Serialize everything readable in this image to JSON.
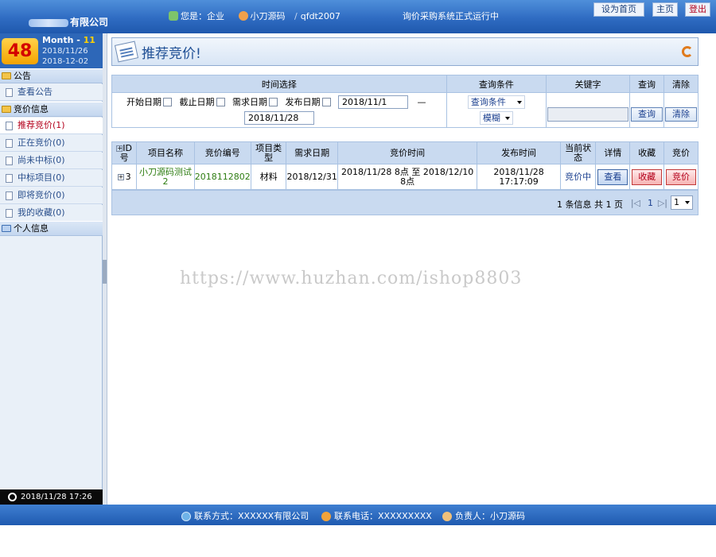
{
  "header": {
    "company_suffix": "有限公司",
    "greeting_label": "您是：",
    "role": "企业",
    "user_name": "小刀源码",
    "user_separator": "/",
    "user_id": "qfdt2007",
    "status_text": "询价采购系统正式运行中",
    "btn_homepage": "设为首页",
    "btn_home": "主页",
    "btn_logout": "登出"
  },
  "datebox": {
    "day": "48",
    "month_label": "Month - ",
    "month_num": "11",
    "date1": "2018/11/26",
    "date2": "2018-12-02"
  },
  "sidebar": {
    "sections": [
      {
        "label": "公告",
        "items": [
          {
            "label": "查看公告"
          }
        ]
      },
      {
        "label": "竞价信息",
        "items": [
          {
            "label": "推荐竞价(1)",
            "active": true
          },
          {
            "label": "正在竞价(0)"
          },
          {
            "label": "尚未中标(0)"
          },
          {
            "label": "中标项目(0)"
          },
          {
            "label": "即将竞价(0)"
          },
          {
            "label": "我的收藏(0)"
          }
        ]
      },
      {
        "label": "个人信息",
        "items": []
      }
    ],
    "clock": "2018/11/28 17:26"
  },
  "page_title": "推荐竞价!",
  "search": {
    "headers": {
      "time": "时间选择",
      "condition": "查询条件",
      "keyword": "关键字",
      "query": "查询",
      "clear": "清除"
    },
    "checks": [
      "开始日期",
      "截止日期",
      "需求日期",
      "发布日期"
    ],
    "date_from": "2018/11/1",
    "date_sep": "—",
    "date_to": "2018/11/28",
    "condition_select": "查询条件",
    "match_select": "模糊",
    "keyword_value": "",
    "btn_query": "查询",
    "btn_clear": "清除"
  },
  "table": {
    "columns": [
      "ID号",
      "项目名称",
      "竞价编号",
      "项目类型",
      "需求日期",
      "竞价时间",
      "发布时间",
      "当前状态",
      "详情",
      "收藏",
      "竞价"
    ],
    "rows": [
      {
        "id": "3",
        "name": "小刀源码测试2",
        "code": "2018112802",
        "type": "材料",
        "need_date": "2018/12/31",
        "bid_time": "2018/11/28 8点 至 2018/12/10 8点",
        "publish_time": "2018/11/28 17:17:09",
        "status": "竞价中",
        "detail_btn": "查看",
        "fav_btn": "收藏",
        "bid_btn": "竞价"
      }
    ]
  },
  "pager": {
    "info": "1 条信息  共 1 页",
    "current": "1",
    "select_value": "1"
  },
  "watermark": "https://www.huzhan.com/ishop8803",
  "footer": {
    "contact": "联系方式：XXXXXX有限公司",
    "phone": "联系电话：XXXXXXXXX",
    "owner": "负责人：小刀源码"
  },
  "colors": {
    "brand_blue": "#2f6cc2",
    "active_red": "#b3001b",
    "accent_green": "#2e7d12"
  }
}
